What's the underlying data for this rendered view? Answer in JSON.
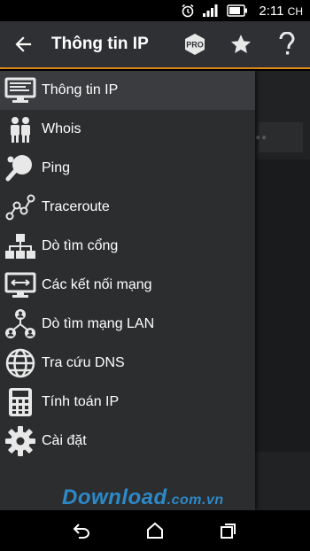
{
  "status_bar": {
    "time": "2:11",
    "time_suffix": "CH"
  },
  "app_bar": {
    "title": "Thông tin IP",
    "pro_badge": "PRO"
  },
  "drawer": {
    "items": [
      {
        "label": "Thông tin IP",
        "icon": "monitor-icon"
      },
      {
        "label": "Whois",
        "icon": "people-icon"
      },
      {
        "label": "Ping",
        "icon": "ping-pong-icon"
      },
      {
        "label": "Traceroute",
        "icon": "traceroute-icon"
      },
      {
        "label": "Dò tìm cổng",
        "icon": "network-tree-icon"
      },
      {
        "label": "Các kết nối mạng",
        "icon": "connections-icon"
      },
      {
        "label": "Dò tìm mạng LAN",
        "icon": "lan-icon"
      },
      {
        "label": "Tra cứu DNS",
        "icon": "globe-icon"
      },
      {
        "label": "Tính toán IP",
        "icon": "calculator-icon"
      },
      {
        "label": "Cài đặt",
        "icon": "gear-icon"
      }
    ]
  },
  "watermark": {
    "text": "Download",
    "domain": ".com.vn"
  },
  "colors": {
    "accent": "#e58a1f",
    "drawer_bg": "#2b2d2f",
    "appbar_bg": "#2e3033"
  }
}
